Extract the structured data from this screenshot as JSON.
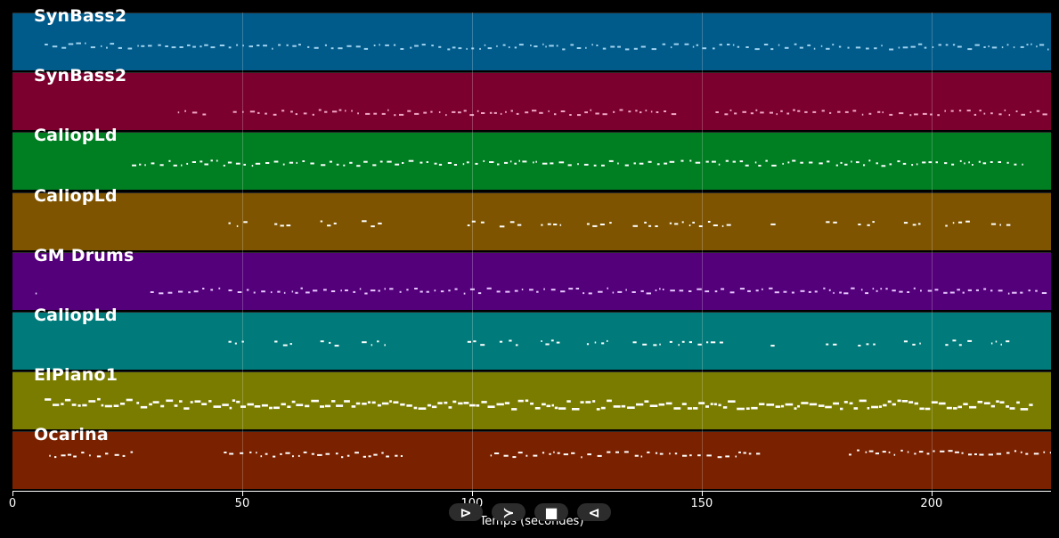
{
  "x_axis": {
    "label": "Temps (secondes)",
    "ticks": [
      "0",
      "50",
      "100",
      "150",
      "200"
    ],
    "range": [
      0,
      226
    ]
  },
  "tracks": [
    {
      "name": "SynBass2",
      "color": "#005a8a",
      "note_color": "#9fd3f0"
    },
    {
      "name": "SynBass2",
      "color": "#7c002e",
      "note_color": "#f0a7c4"
    },
    {
      "name": "CaliopLd",
      "color": "#007e22",
      "note_color": "#ffffff"
    },
    {
      "name": "CaliopLd",
      "color": "#7e5400",
      "note_color": "#ffffff"
    },
    {
      "name": "GM Drums",
      "color": "#55007b",
      "note_color": "#e8c9ff"
    },
    {
      "name": "CaliopLd",
      "color": "#007a7a",
      "note_color": "#ffffff"
    },
    {
      "name": "ElPiano1",
      "color": "#7a7c00",
      "note_color": "#ffffff"
    },
    {
      "name": "Ocarina",
      "color": "#7a2100",
      "note_color": "#ffffff"
    }
  ],
  "controls": [
    {
      "name": "play-alt-button",
      "glyph": "⊳"
    },
    {
      "name": "forward-button",
      "glyph": "≻"
    },
    {
      "name": "stop-button",
      "glyph": "■"
    },
    {
      "name": "rewind-button",
      "glyph": "⊲"
    }
  ]
}
